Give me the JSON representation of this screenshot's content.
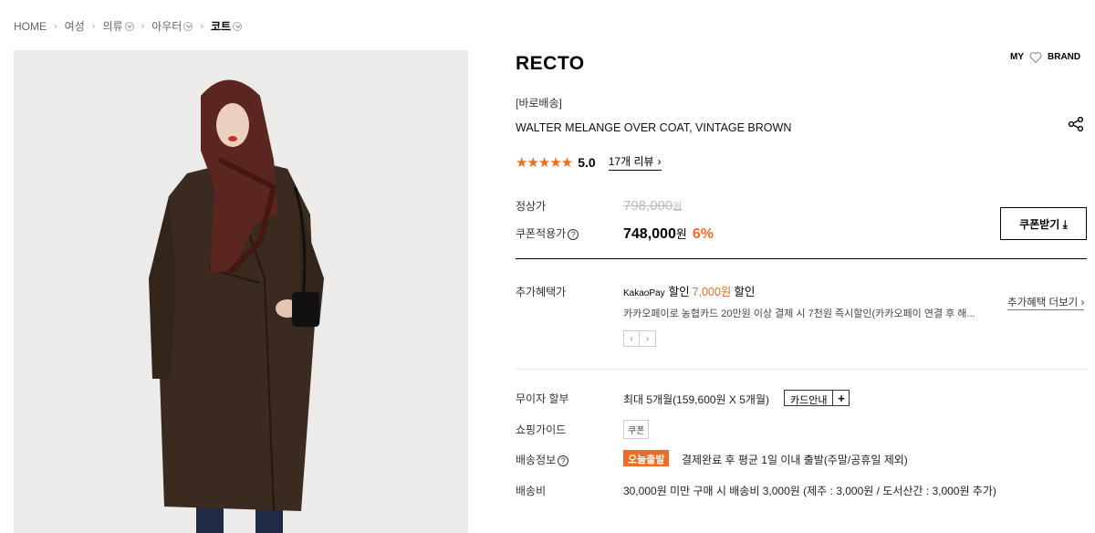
{
  "breadcrumb": [
    "HOME",
    "여성",
    "의류",
    "아우터",
    "코트"
  ],
  "product": {
    "brand": "RECTO",
    "my_label": "MY",
    "brand_label": "BRAND",
    "tag": "[바로배송]",
    "name": "WALTER MELANGE OVER COAT, VINTAGE BROWN",
    "stars": "★★★★★",
    "score": "5.0",
    "reviews": "17개 리뷰"
  },
  "price": {
    "regular_label": "정상가",
    "regular": "798,000",
    "won": "원",
    "coupon_label": "쿠폰적용가",
    "coupon_price": "748,000",
    "discount": "6%",
    "coupon_button": "쿠폰받기 ⤓"
  },
  "benefit": {
    "label": "추가혜택가",
    "kakaopay": "KakaoPay",
    "discount_word": "할인",
    "amount": "7,000원",
    "desc": "카카오페이로 농협카드 20만원 이상 결제 시 7천원 즉시할인(카카오페이 연결 후 해...",
    "more": "추가혜택 더보기 ›",
    "prev": "‹",
    "next": "›"
  },
  "installment": {
    "label": "무이자 할부",
    "value": "최대 5개월(159,600원 X 5개월)",
    "card_button": "카드안내",
    "plus": "+"
  },
  "guide": {
    "label": "쇼핑가이드",
    "chip": "쿠폰"
  },
  "shipping": {
    "label": "배송정보",
    "badge": "오늘출발",
    "text": "결제완료 후 평균 1일 이내 출발(주말/공휴일 제외)",
    "fee_label": "배송비",
    "fee": "30,000원 미만 구매 시 배송비 3,000원 (제주 : 3,000원 / 도서산간 : 3,000원 추가)"
  },
  "colors": {
    "accent": "#f26b22",
    "photo_bg": "#ecebea",
    "coat": "#3a2a1f"
  }
}
